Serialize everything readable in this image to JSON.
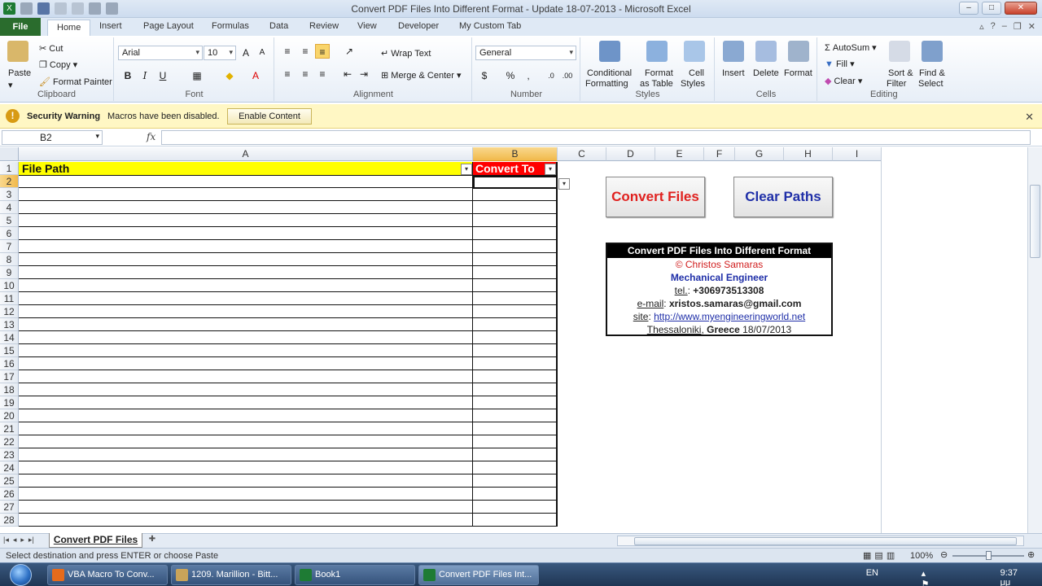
{
  "window": {
    "title": "Convert PDF Files Into Different Format - Update 18-07-2013  -  Microsoft Excel"
  },
  "ribbon_tabs": [
    "File",
    "Home",
    "Insert",
    "Page Layout",
    "Formulas",
    "Data",
    "Review",
    "View",
    "Developer",
    "My Custom Tab"
  ],
  "ribbon": {
    "clipboard": {
      "paste": "Paste",
      "cut": "Cut",
      "copy": "Copy",
      "format_painter": "Format Painter",
      "label": "Clipboard"
    },
    "font": {
      "name": "Arial",
      "size": "10",
      "label": "Font"
    },
    "alignment": {
      "wrap": "Wrap Text",
      "merge": "Merge & Center",
      "label": "Alignment"
    },
    "number": {
      "format": "General",
      "label": "Number"
    },
    "styles": {
      "conditional": "Conditional",
      "conditional2": "Formatting",
      "format_as": "Format",
      "format_as2": "as Table",
      "cell": "Cell",
      "cell2": "Styles",
      "label": "Styles"
    },
    "cells": {
      "insert": "Insert",
      "delete": "Delete",
      "format": "Format",
      "label": "Cells"
    },
    "editing": {
      "autosum": "AutoSum",
      "fill": "Fill",
      "clear": "Clear",
      "sort": "Sort &",
      "sort2": "Filter",
      "find": "Find &",
      "find2": "Select",
      "label": "Editing"
    }
  },
  "security": {
    "title": "Security Warning",
    "message": "Macros have been disabled.",
    "button": "Enable Content"
  },
  "formula_bar": {
    "name_box": "B2",
    "fx": "fx",
    "formula": ""
  },
  "grid": {
    "columns": [
      "A",
      "B",
      "C",
      "D",
      "E",
      "F",
      "G",
      "H",
      "I"
    ],
    "rows": [
      "1",
      "2",
      "3",
      "4",
      "5",
      "6",
      "7",
      "8",
      "9",
      "10",
      "11",
      "12",
      "13",
      "14",
      "15",
      "16",
      "17",
      "18",
      "19",
      "20",
      "21",
      "22",
      "23",
      "24",
      "25",
      "26",
      "27",
      "28"
    ],
    "header_a": "File Path",
    "header_b": "Convert To",
    "colors": {
      "header_a_bg": "#ffff00",
      "header_b_bg": "#ff0000"
    }
  },
  "buttons": {
    "convert": "Convert Files",
    "clear": "Clear Paths",
    "convert_color": "#e0201e",
    "clear_color": "#1f2fa8"
  },
  "info": {
    "title": "Convert PDF Files Into Different Format",
    "author": "© Christos Samaras",
    "role": "Mechanical Engineer",
    "tel_label": "tel.",
    "tel": "+306973513308",
    "email_label": "e-mail",
    "email": "xristos.samaras@gmail.com",
    "site_label": "site",
    "site": "http://www.myengineeringworld.net",
    "city": "Thessaloniki",
    "country": "Greece",
    "date": "18/07/2013"
  },
  "sheet": {
    "tab": "Convert PDF Files"
  },
  "status": {
    "text": "Select destination and press ENTER or choose Paste",
    "zoom": "100%"
  },
  "taskbar": {
    "items": [
      "VBA Macro To Conv...",
      "1209. Marillion - Bitt...",
      "Book1",
      "Convert PDF Files Int..."
    ],
    "lang": "EN",
    "time": "9:37 μμ"
  }
}
